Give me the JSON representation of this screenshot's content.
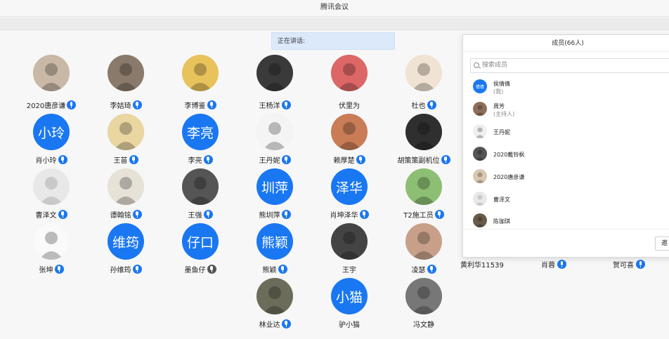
{
  "window": {
    "title": "腾讯会议"
  },
  "speaking_label": "正在讲话:",
  "participants": [
    {
      "name": "2020唐彦谦",
      "avatar": "photo",
      "mic": "on"
    },
    {
      "name": "李姞琦",
      "avatar": "photo",
      "mic": "on"
    },
    {
      "name": "李博鉴",
      "avatar": "photo",
      "mic": "on"
    },
    {
      "name": "王杨洋",
      "avatar": "photo",
      "mic": "on"
    },
    {
      "name": "伏里为",
      "avatar": "photo",
      "mic": "none"
    },
    {
      "name": "杜也",
      "avatar": "photo",
      "mic": "on"
    },
    {
      "name": "肖小玲",
      "avatar": "blue",
      "initials": "小玲",
      "mic": "on"
    },
    {
      "name": "王苗",
      "avatar": "photo",
      "mic": "on"
    },
    {
      "name": "李亮",
      "avatar": "blue",
      "initials": "李亮",
      "mic": "on"
    },
    {
      "name": "王丹妮",
      "avatar": "photo",
      "mic": "on"
    },
    {
      "name": "赖厚楚",
      "avatar": "photo",
      "mic": "on"
    },
    {
      "name": "胡策策副机位",
      "avatar": "photo",
      "mic": "on"
    },
    {
      "name": "曹泽文",
      "avatar": "blank",
      "mic": "on"
    },
    {
      "name": "谭翰铭",
      "avatar": "photo",
      "mic": "on"
    },
    {
      "name": "王强",
      "avatar": "photo",
      "mic": "on"
    },
    {
      "name": "熊圳萍",
      "avatar": "blue",
      "initials": "圳萍",
      "mic": "on"
    },
    {
      "name": "肖坤泽华",
      "avatar": "blue",
      "initials": "泽华",
      "mic": "on"
    },
    {
      "name": "T2施工员",
      "avatar": "photo",
      "mic": "on"
    },
    {
      "name": "张坤",
      "avatar": "photo",
      "mic": "on"
    },
    {
      "name": "孙维筠",
      "avatar": "blue",
      "initials": "维筠",
      "mic": "on"
    },
    {
      "name": "墨鱼仔",
      "avatar": "blue",
      "initials": "仔口",
      "mic": "muted"
    },
    {
      "name": "熊颖",
      "avatar": "blue",
      "initials": "熊颖",
      "mic": "on"
    },
    {
      "name": "王宇",
      "avatar": "photo",
      "mic": "none"
    },
    {
      "name": "凌瑟",
      "avatar": "photo",
      "mic": "on"
    },
    {
      "name": "林业达",
      "avatar": "photo",
      "mic": "on"
    },
    {
      "name": "驴小猫",
      "avatar": "blue",
      "initials": "小猫",
      "mic": "none"
    },
    {
      "name": "冯文静",
      "avatar": "photo",
      "mic": "none"
    }
  ],
  "row_four_tail": [
    {
      "name": "黄利华11539",
      "mic": "none"
    },
    {
      "name": "肖蓉",
      "mic": "on"
    },
    {
      "name": "贺可喜",
      "mic": "on"
    }
  ],
  "members_panel": {
    "title": "成员(66人)",
    "search_placeholder": "搜索成员",
    "members": [
      {
        "name": "侯倩倩",
        "sub": "(我)",
        "avatar": "blue",
        "initials": "倩倩"
      },
      {
        "name": "周芳",
        "sub": "(主持人)",
        "avatar": "photo"
      },
      {
        "name": "王丹妮",
        "sub": "",
        "avatar": "photo"
      },
      {
        "name": "2020戴铃枫",
        "sub": "",
        "avatar": "photo"
      },
      {
        "name": "2020唐彦谦",
        "sub": "",
        "avatar": "photo"
      },
      {
        "name": "曹泽文",
        "sub": "",
        "avatar": "blank"
      },
      {
        "name": "陈珈琪",
        "sub": "",
        "avatar": "photo"
      }
    ],
    "footer_button": "邀"
  },
  "colors": {
    "accent": "#1a77f2",
    "speaking_bg": "#dbe9fb"
  }
}
